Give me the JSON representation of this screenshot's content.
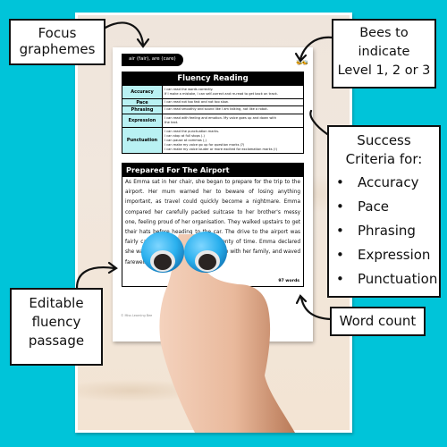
{
  "worksheet": {
    "grapheme_label": "air (fair), are (care)",
    "bees_glyph": "🐝🐝",
    "fluency_table": {
      "title": "Fluency Reading",
      "rows": [
        {
          "label": "Accuracy",
          "lines": [
            "I can read the words correctly.",
            "If I make a mistake, I can self-correct and re-read to get back on track."
          ]
        },
        {
          "label": "Pace",
          "lines": [
            "I can read not too fast and not too slow."
          ]
        },
        {
          "label": "Phrasing",
          "lines": [
            "I can read smoothly and sound like I am talking, not like a robot."
          ]
        },
        {
          "label": "Expression",
          "lines": [
            "I can read with feeling and emotion. My voice goes up and down with",
            "the text."
          ]
        },
        {
          "label": "Punctuation",
          "lines": [
            "I can read the punctuation marks.",
            "I can stop at full stops (.)",
            "I can pause at commas (,)",
            "I can make my voice go up for question marks (?)",
            "I can make my voice louder or more excited for exclamation marks (!)"
          ]
        }
      ]
    },
    "passage": {
      "title": "Prepared For The Airport",
      "text": "As Emma sat in her chair, she began to prepare for the trip to the airport. Her mum warned her to beware of losing anything important, as travel could quickly become a nightmare. Emma compared her carefully packed suitcase to her brother's messy one, feeling proud of her organisation. They walked upstairs to get their hats before heading to the car. The drive to the airport was fairly calm, and they arrived with plenty of time. Emma declared she was excited to share this adventure with her family, and waved farewell as they boarded the airplane.",
      "word_count": "97 words"
    },
    "copyright": "© Miss Learning Bee"
  },
  "callouts": {
    "focus": [
      "Focus",
      "graphemes"
    ],
    "bees": [
      "Bees to",
      "indicate",
      "Level 1, 2 or 3"
    ],
    "criteria": {
      "title": [
        "Success",
        "Criteria for:"
      ],
      "items": [
        "Accuracy",
        "Pace",
        "Phrasing",
        "Expression",
        "Punctuation"
      ]
    },
    "passage": [
      "Editable",
      "fluency",
      "passage"
    ],
    "word_count": "Word count"
  },
  "colors": {
    "background": "#00c4d9",
    "table_label_fill": "#b9f1f3",
    "eyeball_blue": "#2ab0ee"
  }
}
